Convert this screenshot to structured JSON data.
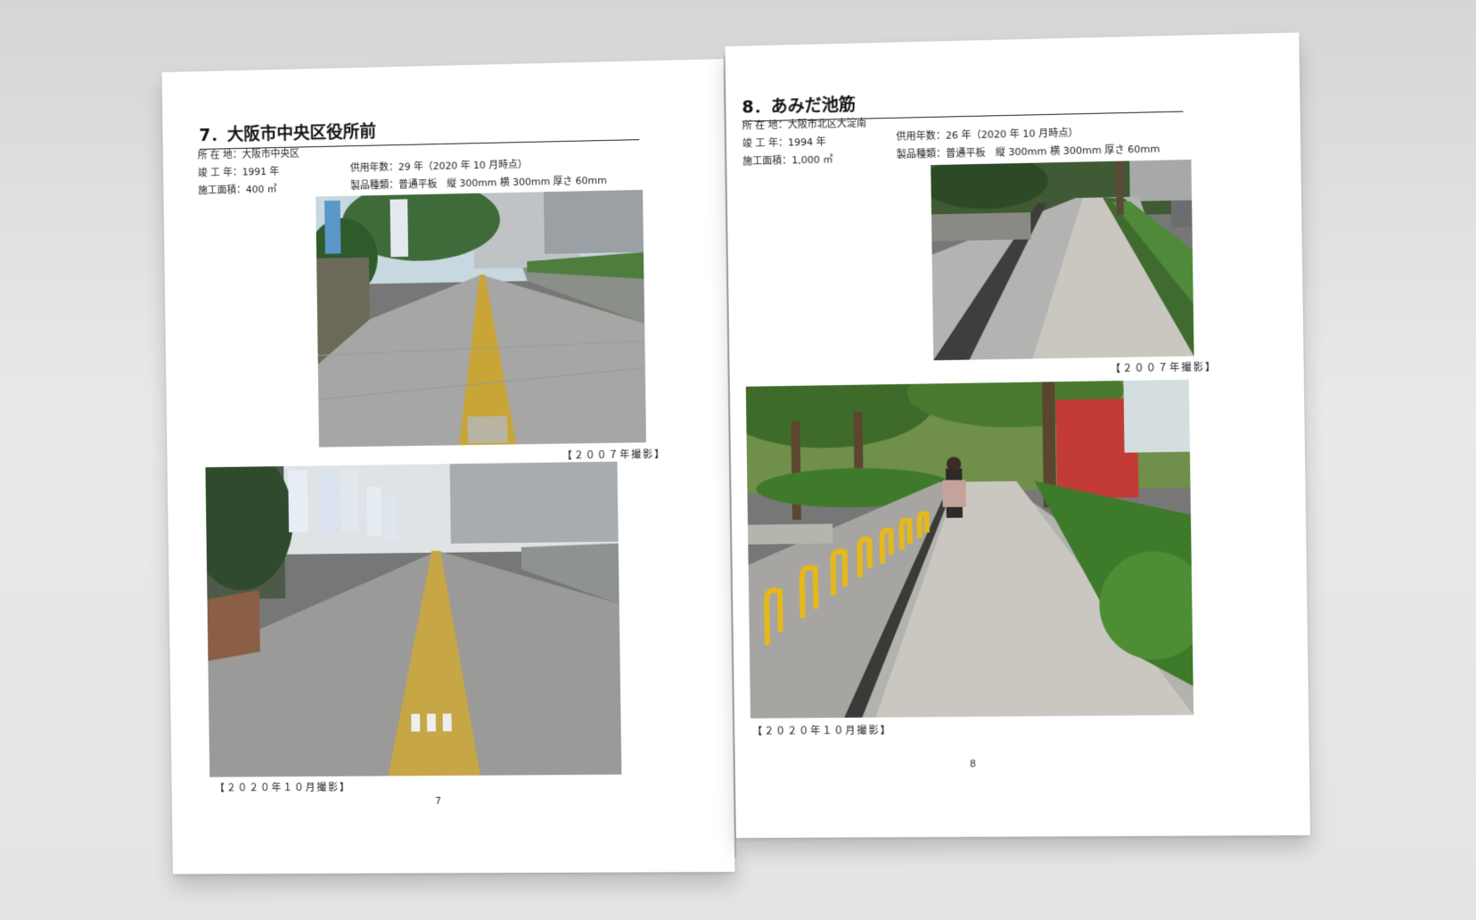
{
  "left_page": {
    "title": "7．大阪市中央区役所前",
    "location": "所 在 地：大阪市中央区",
    "completed": "竣 工 年：1991 年",
    "area": "施工面積：400 ㎡",
    "service_years": "供用年数：29 年（2020 年 10 月時点）",
    "product": "製品種類：普通平板　縦 300mm 横 300mm 厚さ 60mm",
    "caption_2007": "【２００７年撮影】",
    "caption_2020": "【２０２０年１０月撮影】",
    "page_number": "7"
  },
  "right_page": {
    "title": "8．あみだ池筋",
    "location": "所 在 地：大阪市北区大淀南",
    "completed": "竣 工 年：1994 年",
    "area": "施工面積：1,000 ㎡",
    "service_years": "供用年数：26 年（2020 年 10 月時点）",
    "product": "製品種類：普通平板　縦 300mm 横 300mm 厚さ 60mm",
    "caption_2007": "【２００７年撮影】",
    "caption_2020": "【２０２０年１０月撮影】",
    "page_number": "8"
  }
}
